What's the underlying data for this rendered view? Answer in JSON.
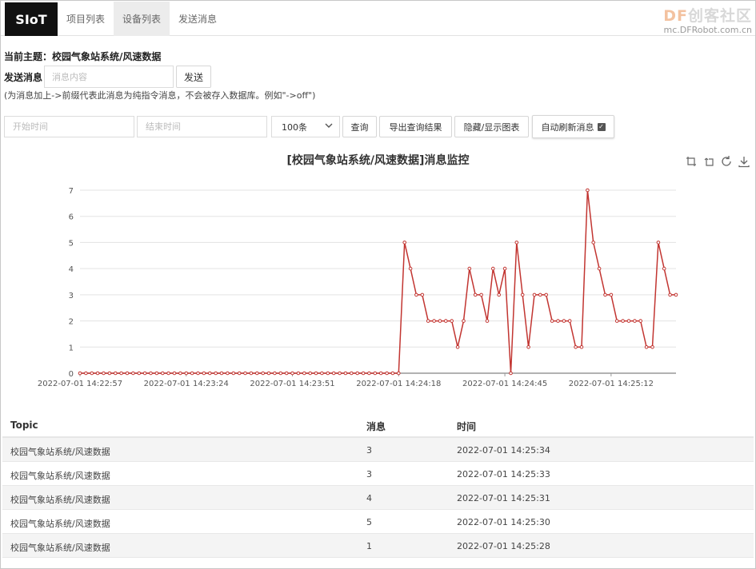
{
  "nav": {
    "brand": "SIoT",
    "tabs": [
      {
        "label": "项目列表",
        "active": false
      },
      {
        "label": "设备列表",
        "active": true
      },
      {
        "label": "发送消息",
        "active": false
      }
    ]
  },
  "watermark": {
    "prefix": "DF",
    "main": "创客社区",
    "sub": "mc.DFRobot.com.cn"
  },
  "topic": {
    "label": "当前主题：",
    "value": "校园气象站系统/风速数据"
  },
  "send": {
    "label": "发送消息",
    "placeholder": "消息内容",
    "button": "发送",
    "hint": "(为消息加上->前缀代表此消息为纯指令消息，不会被存入数据库。例如\"->off\")"
  },
  "filters": {
    "start_placeholder": "开始时间",
    "end_placeholder": "结束时间",
    "limit_value": "100条",
    "query_button": "查询",
    "export_button": "导出查询结果",
    "toggle_chart_button": "隐藏/显示图表",
    "auto_refresh_label": "自动刷新消息",
    "auto_refresh_checked": true
  },
  "chart_tools": [
    "zoom-icon",
    "zoom-reset-icon",
    "refresh-icon",
    "download-icon"
  ],
  "chart_data": {
    "type": "line",
    "title": "[校园气象站系统/风速数据]消息监控",
    "ylim": [
      0,
      7
    ],
    "yticks": [
      0,
      1,
      2,
      3,
      4,
      5,
      6,
      7
    ],
    "xtick_labels": [
      "2022-07-01 14:22:57",
      "2022-07-01 14:23:24",
      "2022-07-01 14:23:51",
      "2022-07-01 14:24:18",
      "2022-07-01 14:24:45",
      "2022-07-01 14:25:12"
    ],
    "grid": true,
    "color": "#c23531",
    "series": [
      {
        "values": [
          0,
          0,
          0,
          0,
          0,
          0,
          0,
          0,
          0,
          0,
          0,
          0,
          0,
          0,
          0,
          0,
          0,
          0,
          0,
          0,
          0,
          0,
          0,
          0,
          0,
          0,
          0,
          0,
          0,
          0,
          0,
          0,
          0,
          0,
          0,
          0,
          0,
          0,
          0,
          0,
          0,
          0,
          0,
          0,
          0,
          0,
          0,
          0,
          0,
          0,
          0,
          0,
          0,
          0,
          0,
          5,
          4,
          3,
          3,
          2,
          2,
          2,
          2,
          2,
          1,
          2,
          4,
          3,
          3,
          2,
          4,
          3,
          4,
          0,
          5,
          3,
          1,
          3,
          3,
          3,
          2,
          2,
          2,
          2,
          1,
          1,
          7,
          5,
          4,
          3,
          3,
          2,
          2,
          2,
          2,
          2,
          1,
          1,
          5,
          4,
          3,
          3
        ]
      }
    ]
  },
  "table": {
    "headers": [
      "Topic",
      "消息",
      "时间"
    ],
    "rows": [
      [
        "校园气象站系统/风速数据",
        "3",
        "2022-07-01 14:25:34"
      ],
      [
        "校园气象站系统/风速数据",
        "3",
        "2022-07-01 14:25:33"
      ],
      [
        "校园气象站系统/风速数据",
        "4",
        "2022-07-01 14:25:31"
      ],
      [
        "校园气象站系统/风速数据",
        "5",
        "2022-07-01 14:25:30"
      ],
      [
        "校园气象站系统/风速数据",
        "1",
        "2022-07-01 14:25:28"
      ]
    ]
  }
}
